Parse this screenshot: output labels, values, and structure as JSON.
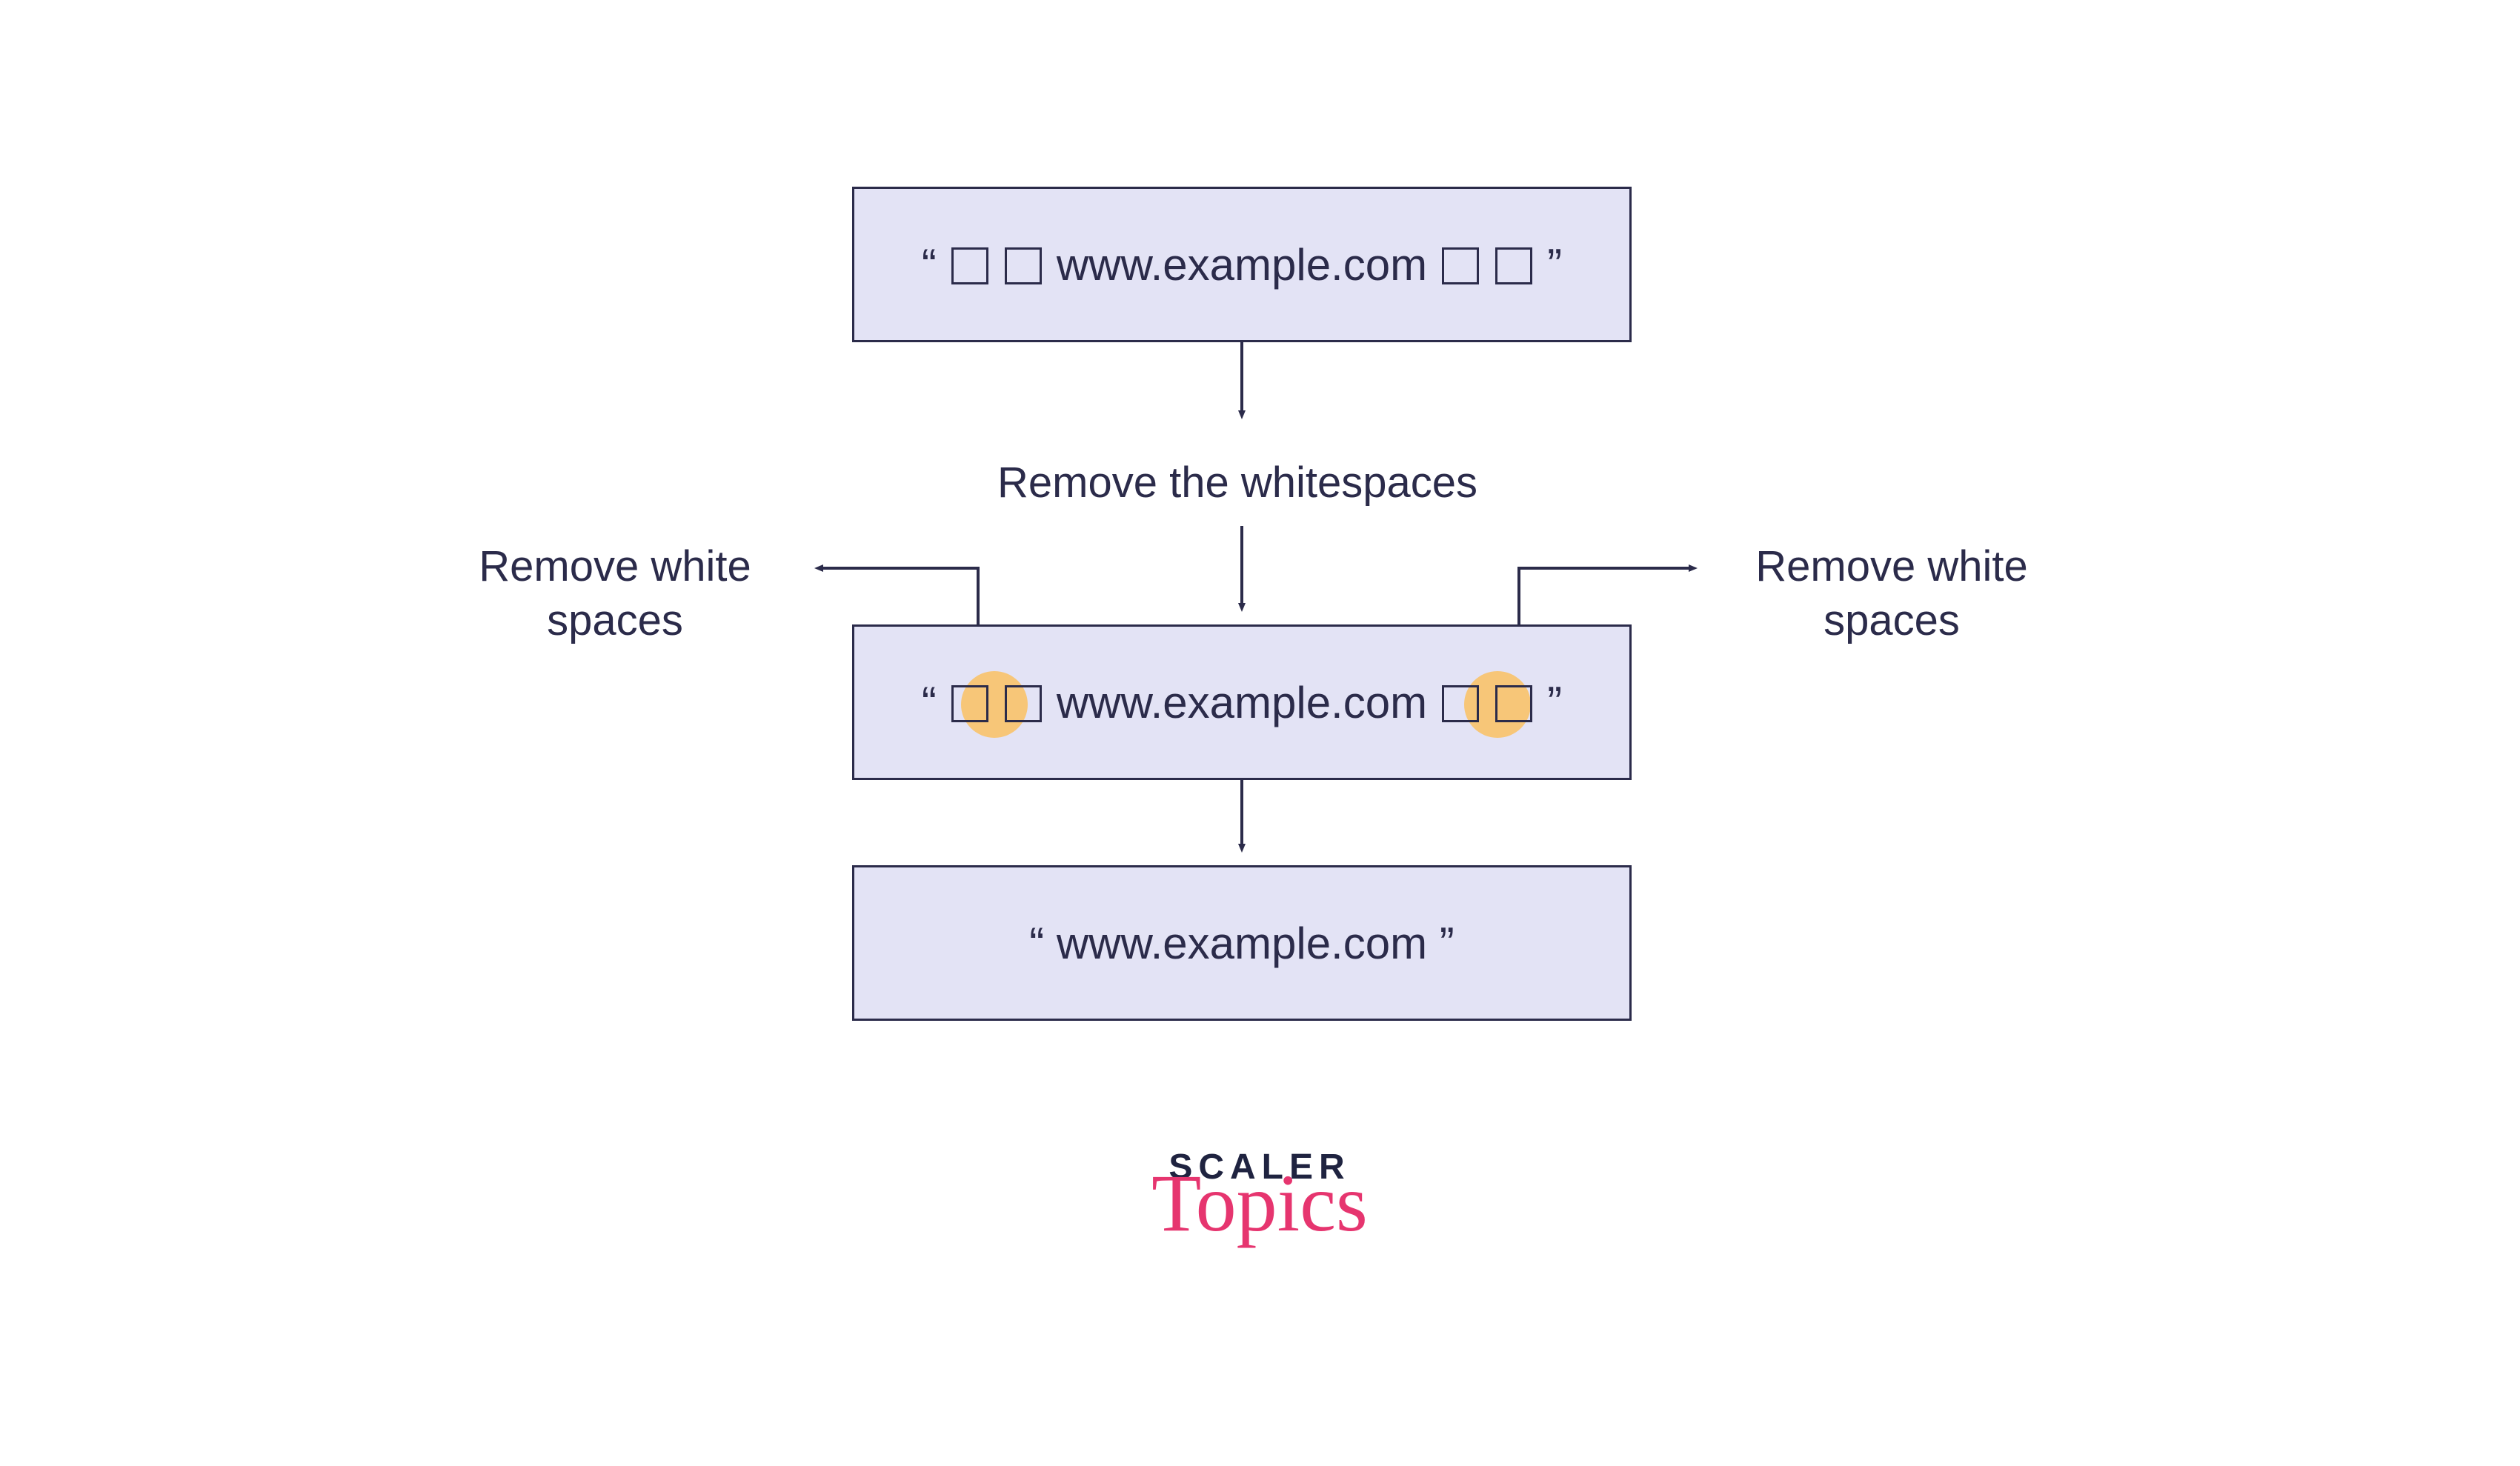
{
  "boxes": {
    "input": {
      "quote_open": "“",
      "quote_close": "”",
      "url": "www.example.com",
      "leading_ws_count": 2,
      "trailing_ws_count": 2
    },
    "middle": {
      "quote_open": "“",
      "quote_close": "”",
      "url": "www.example.com",
      "leading_ws_count": 2,
      "trailing_ws_count": 2,
      "highlight_left": true,
      "highlight_right": true
    },
    "output": {
      "quote_open": "“",
      "quote_close": "”",
      "url": "www.example.com"
    }
  },
  "labels": {
    "step1": "Remove the whitespaces",
    "left_line1": "Remove white",
    "left_line2": "spaces",
    "right_line1": "Remove white",
    "right_line2": "spaces"
  },
  "logo": {
    "line1": "SCALER",
    "line2": "Topics"
  },
  "colors": {
    "box_fill": "#e3e3f5",
    "box_border": "#2b2b4a",
    "text": "#2b2b4a",
    "highlight": "#f7c678",
    "logo_dark": "#1f2340",
    "logo_pink": "#e6356f"
  }
}
